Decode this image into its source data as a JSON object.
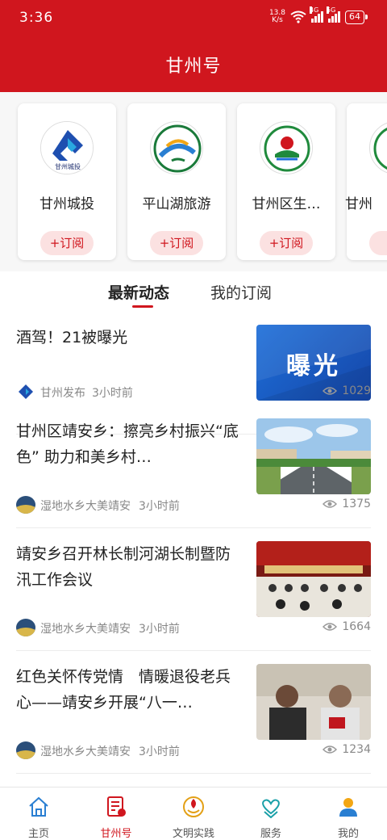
{
  "status": {
    "time": "3:36",
    "speed_top": "13.8",
    "speed_bottom": "K/s",
    "net1": "4G",
    "net2": "5G",
    "battery": "64"
  },
  "header": {
    "title": "甘州号"
  },
  "accounts": [
    {
      "name": "甘州城投",
      "subscribe": "+订阅"
    },
    {
      "name": "平山湖旅游",
      "subscribe": "+订阅"
    },
    {
      "name": "甘州区生…",
      "subscribe": "+订阅"
    },
    {
      "name": "甘州",
      "subscribe": "+"
    }
  ],
  "tabs": [
    {
      "label": "最新动态"
    },
    {
      "label": "我的订阅"
    }
  ],
  "feed": [
    {
      "title": "酒驾！21被曝光",
      "source": "甘州发布",
      "time": "3小时前",
      "views": "1029",
      "thumb_text": "曝光"
    },
    {
      "title": "甘州区靖安乡：擦亮乡村振兴“底色” 助力和美乡村…",
      "source": "湿地水乡大美靖安",
      "time": "3小时前",
      "views": "1375"
    },
    {
      "title": "靖安乡召开林长制河湖长制暨防汛工作会议",
      "source": "湿地水乡大美靖安",
      "time": "3小时前",
      "views": "1664"
    },
    {
      "title": "红色关怀传党情　情暖退役老兵心——靖安乡开展“八一…",
      "source": "湿地水乡大美靖安",
      "time": "3小时前",
      "views": "1234"
    }
  ],
  "bottom_nav": [
    {
      "label": "主页"
    },
    {
      "label": "甘州号"
    },
    {
      "label": "文明实践"
    },
    {
      "label": "服务"
    },
    {
      "label": "我的"
    }
  ],
  "colors": {
    "brand": "#d0161e",
    "accent_blue": "#1e6fd9"
  }
}
